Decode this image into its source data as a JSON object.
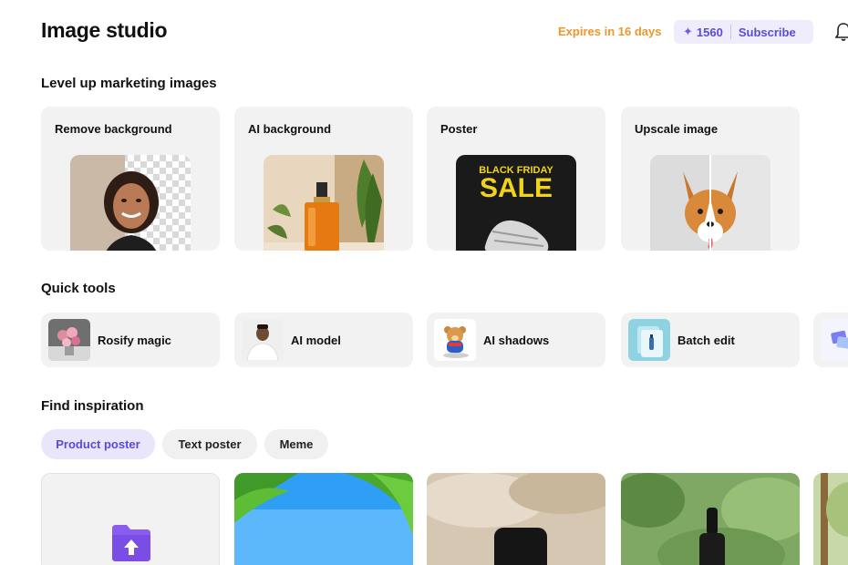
{
  "header": {
    "title": "Image studio",
    "expires": "Expires in 16 days",
    "credits": "1560",
    "subscribe": "Subscribe"
  },
  "sections": {
    "level_up": "Level up marketing images",
    "quick_tools": "Quick tools",
    "inspiration": "Find inspiration"
  },
  "features": [
    {
      "label": "Remove background",
      "icon": "remove-background-illustration"
    },
    {
      "label": "AI background",
      "icon": "ai-background-illustration"
    },
    {
      "label": "Poster",
      "icon": "poster-illustration",
      "poster_line1": "BLACK FRIDAY",
      "poster_line2": "SALE"
    },
    {
      "label": "Upscale image",
      "icon": "upscale-illustration"
    }
  ],
  "tools": [
    {
      "label": "Rosify magic"
    },
    {
      "label": "AI model"
    },
    {
      "label": "AI shadows"
    },
    {
      "label": "Batch edit"
    }
  ],
  "chips": [
    {
      "label": "Product poster",
      "active": true
    },
    {
      "label": "Text poster",
      "active": false
    },
    {
      "label": "Meme",
      "active": false
    }
  ],
  "colors": {
    "accent": "#5a4bd9",
    "expires": "#f0962a",
    "card_bg": "#f2f2f3"
  }
}
